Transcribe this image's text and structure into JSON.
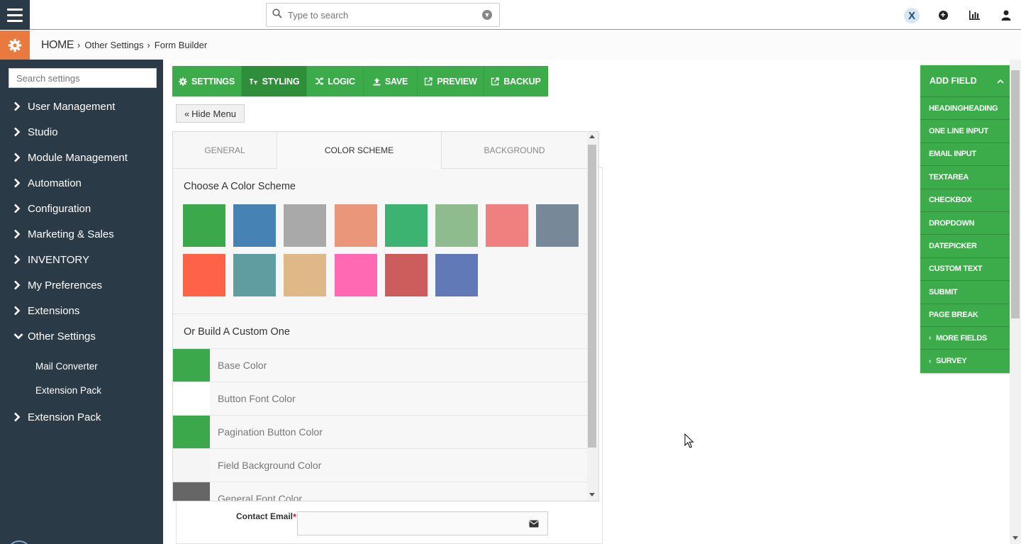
{
  "topbar": {
    "search_placeholder": "Type to search"
  },
  "breadcrumb": {
    "home": "HOME",
    "items": [
      "Other Settings",
      "Form Builder"
    ]
  },
  "sidebar": {
    "search_placeholder": "Search settings",
    "items": [
      {
        "label": "User Management",
        "icon": "chevron-right-icon"
      },
      {
        "label": "Studio",
        "icon": "chevron-right-icon"
      },
      {
        "label": "Module Management",
        "icon": "chevron-right-icon"
      },
      {
        "label": "Automation",
        "icon": "chevron-right-icon"
      },
      {
        "label": "Configuration",
        "icon": "chevron-right-icon"
      },
      {
        "label": "Marketing & Sales",
        "icon": "chevron-right-icon"
      },
      {
        "label": "INVENTORY",
        "icon": "chevron-right-icon"
      },
      {
        "label": "My Preferences",
        "icon": "chevron-right-icon"
      },
      {
        "label": "Extensions",
        "icon": "chevron-right-icon"
      },
      {
        "label": "Other Settings",
        "icon": "chevron-down-icon"
      }
    ],
    "sub_items": [
      "Mail Converter",
      "Extension Pack"
    ],
    "last_item": {
      "label": "Extension Pack",
      "icon": "chevron-right-icon"
    }
  },
  "toolbar": {
    "buttons": [
      {
        "label": "SETTINGS",
        "icon": "gear-icon"
      },
      {
        "label": "STYLING",
        "icon": "text-size-icon"
      },
      {
        "label": "LOGIC",
        "icon": "shuffle-icon"
      },
      {
        "label": "SAVE",
        "icon": "upload-icon"
      },
      {
        "label": "PREVIEW",
        "icon": "external-link-icon"
      },
      {
        "label": "BACKUP",
        "icon": "external-link-icon"
      }
    ],
    "active": "STYLING"
  },
  "hide_menu": {
    "label": "Hide Menu",
    "icon": "double-chevron-left-icon"
  },
  "styling_panel": {
    "tabs": [
      "GENERAL",
      "COLOR SCHEME",
      "BACKGROUND"
    ],
    "active_tab": "COLOR SCHEME",
    "choose_title": "Choose A Color Scheme",
    "swatches": [
      "#3ba84b",
      "#4682b4",
      "#a9a9a9",
      "#e9967a",
      "#3cb371",
      "#8fbc8f",
      "#f08080",
      "#778899",
      "#ff6347",
      "#5f9ea0",
      "#deb887",
      "#ff69b4",
      "#cd5c5c",
      "#6279b8"
    ],
    "custom_title": "Or Build A Custom One",
    "custom_rows": [
      {
        "label": "Base Color",
        "color": "#3ba84b"
      },
      {
        "label": "Button Font Color",
        "color": "#ffffff"
      },
      {
        "label": "Pagination Button Color",
        "color": "#3ba84b"
      },
      {
        "label": "Field Background Color",
        "color": "#f5f5f5"
      },
      {
        "label": "General Font Color",
        "color": "#666666"
      }
    ]
  },
  "form": {
    "contact_label": "Contact Email",
    "required_mark": "*"
  },
  "add_field": {
    "title": "ADD FIELD",
    "items": [
      "HEADINGHEADING",
      "ONE LINE INPUT",
      "EMAIL INPUT",
      "TEXTAREA",
      "CHECKBOX",
      "DROPDOWN",
      "DATEPICKER",
      "CUSTOM TEXT",
      "SUBMIT",
      "PAGE BREAK"
    ],
    "expandable": [
      "MORE FIELDS",
      "SURVEY"
    ]
  },
  "colors": {
    "accent_green": "#3cac4a",
    "sidebar_bg": "#2b3a47",
    "orange": "#e8793f"
  }
}
